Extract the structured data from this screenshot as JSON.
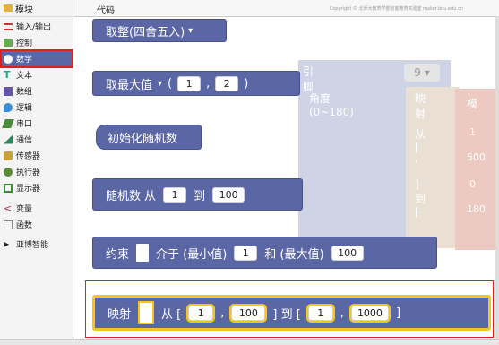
{
  "sidebar": {
    "header": "模块",
    "categories": [
      {
        "label": "输入/输出"
      },
      {
        "label": "控制"
      },
      {
        "label": "数学"
      },
      {
        "label": "文本"
      },
      {
        "label": "数组"
      },
      {
        "label": "逻辑"
      },
      {
        "label": "串口"
      },
      {
        "label": "通信"
      },
      {
        "label": "传感器"
      },
      {
        "label": "执行器"
      },
      {
        "label": "显示器"
      },
      {
        "label": "变量"
      },
      {
        "label": "函数"
      },
      {
        "label": "亚博智能"
      }
    ]
  },
  "topbar": {
    "tab": "代码",
    "copyright": "Copyright © 北师大教育学部创客教育实验室 maker.bnu.edu.cn"
  },
  "background_blocks": {
    "pin_label": "引脚",
    "pin_value": "9",
    "angle_label": "角度 (0~180)",
    "map_label": "映射",
    "from_label": "从 [",
    "to_label": "] 到 [",
    "comma": ",",
    "vals": [
      "1",
      "500",
      "0",
      "180"
    ],
    "right_label": "模"
  },
  "blocks": {
    "round": {
      "label": "取整(四舍五入)",
      "arrow": "▾"
    },
    "max": {
      "label": "取最大值",
      "arrow": "▾",
      "open": "(",
      "a": "1",
      "comma": ",",
      "b": "2",
      "close": ")"
    },
    "randinit": {
      "label": "初始化随机数"
    },
    "random": {
      "label": "随机数 从",
      "from": "1",
      "to_label": "到",
      "to": "100"
    },
    "constrain": {
      "label": "约束",
      "between": "介于 (最小值)",
      "min": "1",
      "and": "和 (最大值)",
      "max": "100"
    },
    "map": {
      "label": "映射",
      "from": "从 [",
      "a": "1",
      "comma": ",",
      "b": "100",
      "to": "] 到 [",
      "c": "1",
      "d": "1000",
      "close": "]"
    }
  },
  "colors": {
    "block": "#5b67a5",
    "highlight": "#f5c518",
    "selection_outline": "#e02020"
  }
}
